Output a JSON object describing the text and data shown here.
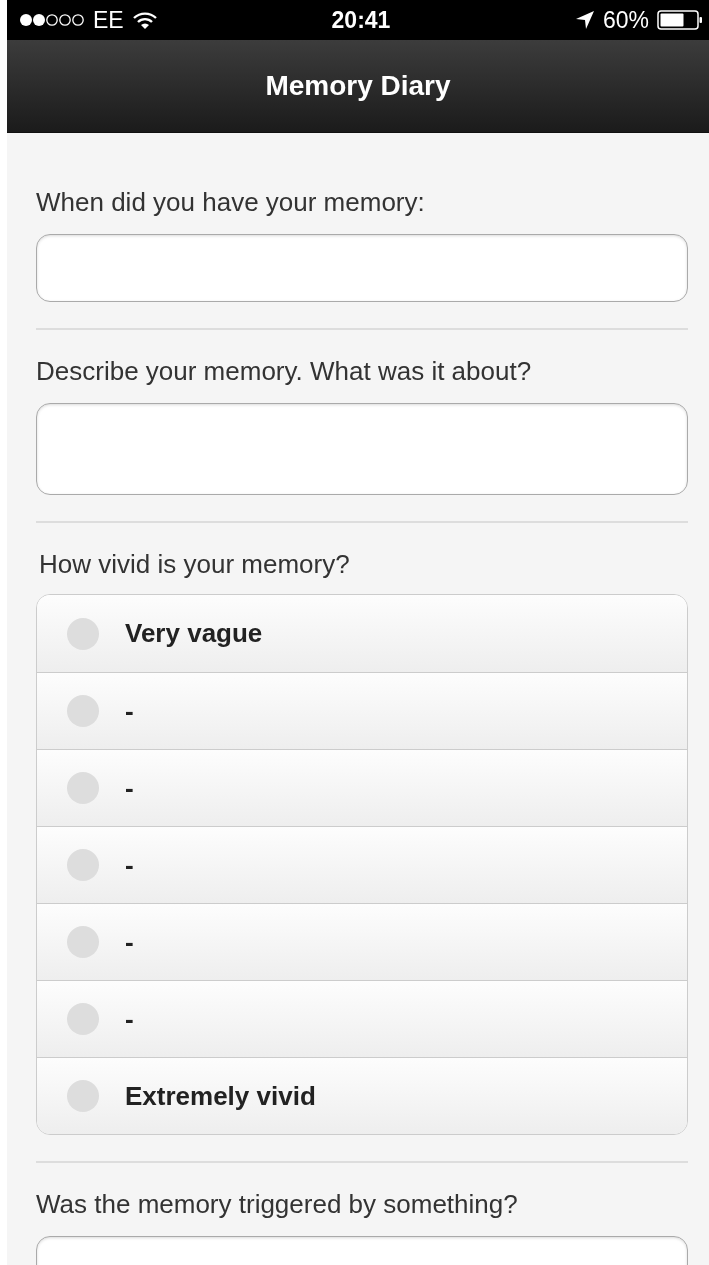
{
  "status_bar": {
    "carrier": "EE",
    "time": "20:41",
    "battery": "60%"
  },
  "header": {
    "title": "Memory Diary"
  },
  "questions": [
    {
      "kind": "text",
      "label": "When did you have your memory:"
    },
    {
      "kind": "textarea",
      "label": "Describe your memory. What was it about?"
    },
    {
      "kind": "radio",
      "label": "How vivid is your memory?",
      "options": [
        {
          "label": "Very vague",
          "selected": false
        },
        {
          "label": "-",
          "selected": false
        },
        {
          "label": "-",
          "selected": false
        },
        {
          "label": "-",
          "selected": false
        },
        {
          "label": "-",
          "selected": false
        },
        {
          "label": "-",
          "selected": false
        },
        {
          "label": "Extremely vivid",
          "selected": false
        }
      ]
    },
    {
      "kind": "text",
      "label": "Was the memory triggered by something?"
    }
  ]
}
